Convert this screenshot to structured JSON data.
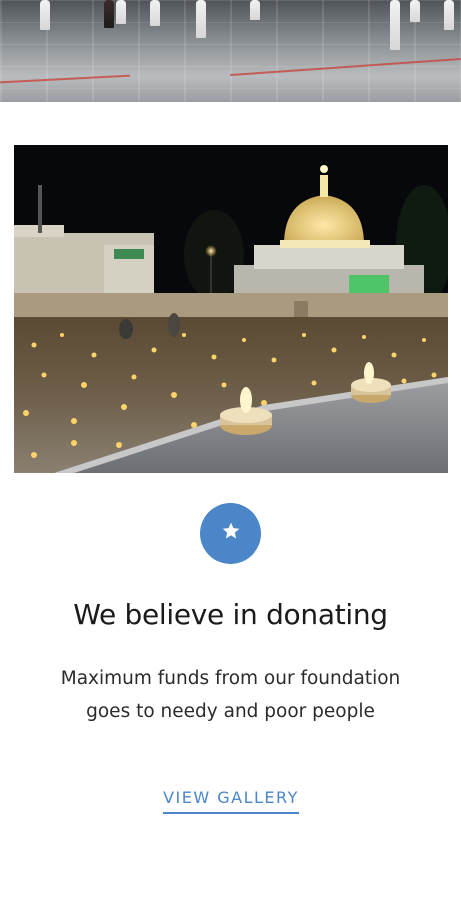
{
  "hero": {
    "top_image": "courtyard-photo",
    "main_image": "shrine-night-candles-photo"
  },
  "feature": {
    "icon": "star-icon",
    "icon_color": "#4a86c8",
    "title": "We believe in donating",
    "description": "Maximum funds from our foundation goes to needy and poor people",
    "link_label": "VIEW GALLERY",
    "link_color": "#4a86c8"
  }
}
